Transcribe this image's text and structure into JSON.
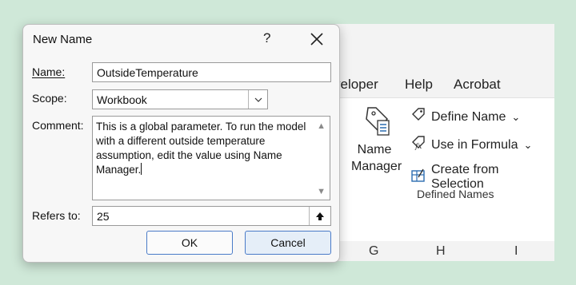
{
  "dialog": {
    "title": "New Name",
    "help": "?",
    "name_label": "Name:",
    "name_value": "OutsideTemperature",
    "scope_label": "Scope:",
    "scope_value": "Workbook",
    "comment_label": "Comment:",
    "comment_value": "This is a global parameter. To run the model\nwith a different outside temperature\nassumption, edit the value using Name\nManager.",
    "refers_label": "Refers to:",
    "refers_value": "25",
    "ok_label": "OK",
    "cancel_label": "Cancel"
  },
  "ribbon": {
    "tabs": [
      "veloper",
      "Help",
      "Acrobat"
    ],
    "name_manager_label": "Name\nManager",
    "define_name": "Define Name",
    "use_in_formula": "Use in Formula",
    "create_from_selection": "Create from Selection",
    "group_label": "Defined Names"
  },
  "sheet": {
    "columns": [
      "G",
      "H",
      "I"
    ]
  },
  "colors": {
    "background": "#cfe8d8",
    "button_border": "#4a7bc8",
    "cancel_fill": "#e5eef8"
  }
}
